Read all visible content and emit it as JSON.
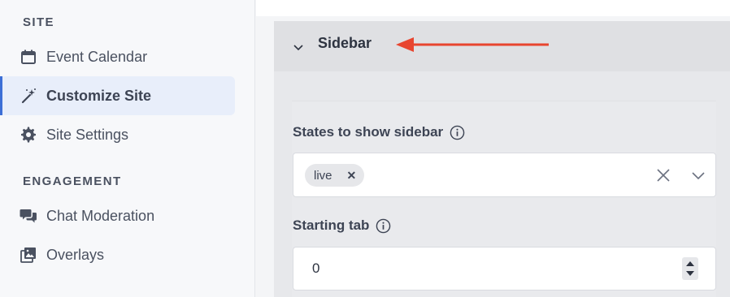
{
  "sidebar": {
    "sections": [
      {
        "title": "SITE",
        "items": [
          {
            "label": "Event Calendar",
            "icon": "calendar-icon"
          },
          {
            "label": "Customize Site",
            "icon": "magic-wand-icon",
            "active": true
          },
          {
            "label": "Site Settings",
            "icon": "gear-icon"
          }
        ]
      },
      {
        "title": "ENGAGEMENT",
        "items": [
          {
            "label": "Chat Moderation",
            "icon": "chat-bubbles-icon"
          },
          {
            "label": "Overlays",
            "icon": "images-icon"
          }
        ]
      }
    ]
  },
  "panel": {
    "title": "Sidebar",
    "annotation_arrow_color": "#e8452f",
    "states_field": {
      "label": "States to show sidebar",
      "chips": [
        {
          "label": "live"
        }
      ]
    },
    "starting_tab_field": {
      "label": "Starting tab",
      "value": "0"
    }
  },
  "colors": {
    "accent": "#3c6fd6",
    "active_bg": "#e8eefa"
  }
}
